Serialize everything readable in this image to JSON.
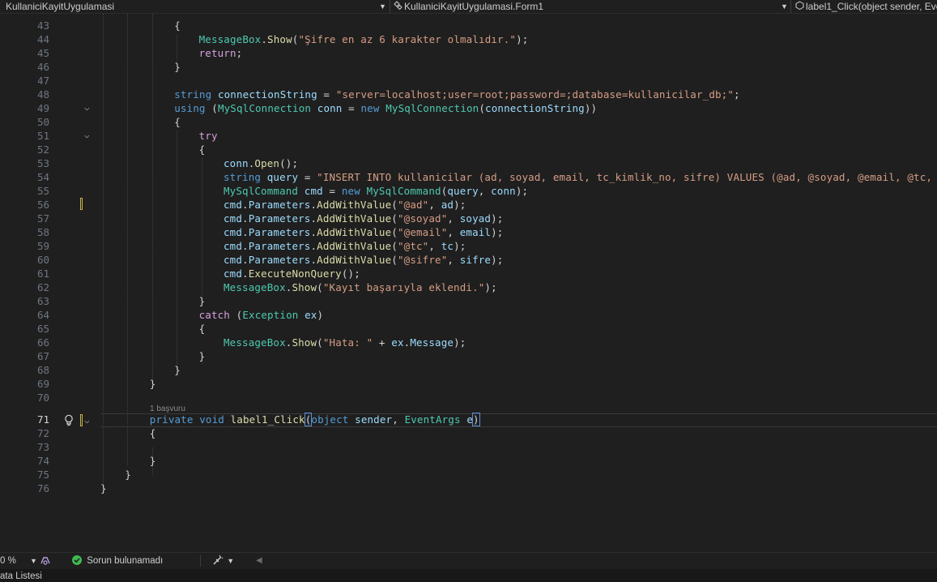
{
  "navbar": {
    "project": "KullaniciKayitUygulamasi",
    "class": "KullaniciKayitUygulamasi.Form1",
    "member": "label1_Click(object sender, Eve"
  },
  "editor": {
    "current_line": 71,
    "codelens": "1 başvuru",
    "lines": [
      {
        "n": 43,
        "tokens": [
          [
            "pl",
            "{"
          ]
        ]
      },
      {
        "n": 44,
        "tokens": [
          [
            "ty",
            "MessageBox"
          ],
          [
            "pl",
            "."
          ],
          [
            "fn",
            "Show"
          ],
          [
            "pl",
            "("
          ],
          [
            "str",
            "\"Şifre en az 6 karakter olmalıdır.\""
          ],
          [
            "pl",
            ");"
          ]
        ]
      },
      {
        "n": 45,
        "tokens": [
          [
            "ctl",
            "return"
          ],
          [
            "pl",
            ";"
          ]
        ]
      },
      {
        "n": 46,
        "tokens": [
          [
            "pl",
            "}"
          ]
        ]
      },
      {
        "n": 47,
        "tokens": []
      },
      {
        "n": 48,
        "tokens": [
          [
            "kw",
            "string"
          ],
          [
            "pl",
            " "
          ],
          [
            "var",
            "connectionString"
          ],
          [
            "pl",
            " = "
          ],
          [
            "str",
            "\"server=localhost;user=root;password=;database=kullanicilar_db;\""
          ],
          [
            "pl",
            ";"
          ]
        ]
      },
      {
        "n": 49,
        "tokens": [
          [
            "kw",
            "using"
          ],
          [
            "pl",
            " ("
          ],
          [
            "ty",
            "MySqlConnection"
          ],
          [
            "pl",
            " "
          ],
          [
            "var",
            "conn"
          ],
          [
            "pl",
            " = "
          ],
          [
            "kw",
            "new"
          ],
          [
            "pl",
            " "
          ],
          [
            "ty",
            "MySqlConnection"
          ],
          [
            "pl",
            "("
          ],
          [
            "var",
            "connectionString"
          ],
          [
            "pl",
            "))"
          ]
        ]
      },
      {
        "n": 50,
        "tokens": [
          [
            "pl",
            "{"
          ]
        ]
      },
      {
        "n": 51,
        "tokens": [
          [
            "ctl",
            "try"
          ]
        ]
      },
      {
        "n": 52,
        "tokens": [
          [
            "pl",
            "{"
          ]
        ]
      },
      {
        "n": 53,
        "tokens": [
          [
            "var",
            "conn"
          ],
          [
            "pl",
            "."
          ],
          [
            "fn",
            "Open"
          ],
          [
            "pl",
            "();"
          ]
        ]
      },
      {
        "n": 54,
        "tokens": [
          [
            "kw",
            "string"
          ],
          [
            "pl",
            " "
          ],
          [
            "var",
            "query"
          ],
          [
            "pl",
            " = "
          ],
          [
            "str",
            "\"INSERT INTO kullanicilar (ad, soyad, email, tc_kimlik_no, sifre) VALUES (@ad, @soyad, @email, @tc, @"
          ]
        ]
      },
      {
        "n": 55,
        "tokens": [
          [
            "ty",
            "MySqlCommand"
          ],
          [
            "pl",
            " "
          ],
          [
            "var",
            "cmd"
          ],
          [
            "pl",
            " = "
          ],
          [
            "kw",
            "new"
          ],
          [
            "pl",
            " "
          ],
          [
            "ty",
            "MySqlCommand"
          ],
          [
            "pl",
            "("
          ],
          [
            "var",
            "query"
          ],
          [
            "pl",
            ", "
          ],
          [
            "var",
            "conn"
          ],
          [
            "pl",
            ");"
          ]
        ]
      },
      {
        "n": 56,
        "tokens": [
          [
            "var",
            "cmd"
          ],
          [
            "pl",
            "."
          ],
          [
            "var",
            "Parameters"
          ],
          [
            "pl",
            "."
          ],
          [
            "fn",
            "AddWithValue"
          ],
          [
            "pl",
            "("
          ],
          [
            "str",
            "\"@ad\""
          ],
          [
            "pl",
            ", "
          ],
          [
            "var",
            "ad"
          ],
          [
            "pl",
            ");"
          ]
        ]
      },
      {
        "n": 57,
        "tokens": [
          [
            "var",
            "cmd"
          ],
          [
            "pl",
            "."
          ],
          [
            "var",
            "Parameters"
          ],
          [
            "pl",
            "."
          ],
          [
            "fn",
            "AddWithValue"
          ],
          [
            "pl",
            "("
          ],
          [
            "str",
            "\"@soyad\""
          ],
          [
            "pl",
            ", "
          ],
          [
            "var",
            "soyad"
          ],
          [
            "pl",
            ");"
          ]
        ]
      },
      {
        "n": 58,
        "tokens": [
          [
            "var",
            "cmd"
          ],
          [
            "pl",
            "."
          ],
          [
            "var",
            "Parameters"
          ],
          [
            "pl",
            "."
          ],
          [
            "fn",
            "AddWithValue"
          ],
          [
            "pl",
            "("
          ],
          [
            "str",
            "\"@email\""
          ],
          [
            "pl",
            ", "
          ],
          [
            "var",
            "email"
          ],
          [
            "pl",
            ");"
          ]
        ]
      },
      {
        "n": 59,
        "tokens": [
          [
            "var",
            "cmd"
          ],
          [
            "pl",
            "."
          ],
          [
            "var",
            "Parameters"
          ],
          [
            "pl",
            "."
          ],
          [
            "fn",
            "AddWithValue"
          ],
          [
            "pl",
            "("
          ],
          [
            "str",
            "\"@tc\""
          ],
          [
            "pl",
            ", "
          ],
          [
            "var",
            "tc"
          ],
          [
            "pl",
            ");"
          ]
        ]
      },
      {
        "n": 60,
        "tokens": [
          [
            "var",
            "cmd"
          ],
          [
            "pl",
            "."
          ],
          [
            "var",
            "Parameters"
          ],
          [
            "pl",
            "."
          ],
          [
            "fn",
            "AddWithValue"
          ],
          [
            "pl",
            "("
          ],
          [
            "str",
            "\"@sifre\""
          ],
          [
            "pl",
            ", "
          ],
          [
            "var",
            "sifre"
          ],
          [
            "pl",
            ");"
          ]
        ]
      },
      {
        "n": 61,
        "tokens": [
          [
            "var",
            "cmd"
          ],
          [
            "pl",
            "."
          ],
          [
            "fn",
            "ExecuteNonQuery"
          ],
          [
            "pl",
            "();"
          ]
        ]
      },
      {
        "n": 62,
        "tokens": [
          [
            "ty",
            "MessageBox"
          ],
          [
            "pl",
            "."
          ],
          [
            "fn",
            "Show"
          ],
          [
            "pl",
            "("
          ],
          [
            "str",
            "\"Kayıt başarıyla eklendi.\""
          ],
          [
            "pl",
            ");"
          ]
        ]
      },
      {
        "n": 63,
        "tokens": [
          [
            "pl",
            "}"
          ]
        ]
      },
      {
        "n": 64,
        "tokens": [
          [
            "ctl",
            "catch"
          ],
          [
            "pl",
            " ("
          ],
          [
            "ty",
            "Exception"
          ],
          [
            "pl",
            " "
          ],
          [
            "var",
            "ex"
          ],
          [
            "pl",
            ")"
          ]
        ]
      },
      {
        "n": 65,
        "tokens": [
          [
            "pl",
            "{"
          ]
        ]
      },
      {
        "n": 66,
        "tokens": [
          [
            "ty",
            "MessageBox"
          ],
          [
            "pl",
            "."
          ],
          [
            "fn",
            "Show"
          ],
          [
            "pl",
            "("
          ],
          [
            "str",
            "\"Hata: \""
          ],
          [
            "pl",
            " + "
          ],
          [
            "var",
            "ex"
          ],
          [
            "pl",
            "."
          ],
          [
            "var",
            "Message"
          ],
          [
            "pl",
            ");"
          ]
        ]
      },
      {
        "n": 67,
        "tokens": [
          [
            "pl",
            "}"
          ]
        ]
      },
      {
        "n": 68,
        "tokens": [
          [
            "pl",
            "}"
          ]
        ]
      },
      {
        "n": 69,
        "tokens": [
          [
            "pl",
            "}"
          ]
        ]
      },
      {
        "n": 70,
        "tokens": []
      },
      {
        "n": 71,
        "tokens": [
          [
            "kw",
            "private"
          ],
          [
            "pl",
            " "
          ],
          [
            "kw",
            "void"
          ],
          [
            "pl",
            " "
          ],
          [
            "fn",
            "label1_Click"
          ],
          [
            "hl",
            "("
          ],
          [
            "kw",
            "object"
          ],
          [
            "pl",
            " "
          ],
          [
            "var",
            "sender"
          ],
          [
            "pl",
            ", "
          ],
          [
            "ty",
            "EventArgs"
          ],
          [
            "pl",
            " "
          ],
          [
            "var",
            "e"
          ],
          [
            "hl",
            ")"
          ]
        ]
      },
      {
        "n": 72,
        "tokens": [
          [
            "pl",
            "{"
          ]
        ]
      },
      {
        "n": 73,
        "tokens": []
      },
      {
        "n": 74,
        "tokens": [
          [
            "pl",
            "}"
          ]
        ]
      },
      {
        "n": 75,
        "tokens": [
          [
            "pl",
            "}"
          ]
        ]
      },
      {
        "n": 76,
        "tokens": [
          [
            "pl",
            "}"
          ]
        ]
      }
    ]
  },
  "statusbar": {
    "zoom": "0 %",
    "issues": "Sorun bulunamadı"
  },
  "bottom_tab": {
    "label": "ata Listesi"
  },
  "colors": {
    "background": "#1f1f1f",
    "keyword": "#569cd6",
    "control": "#d8a0df",
    "type": "#4ec9b0",
    "method": "#dcdcaa",
    "string": "#d69d85",
    "variable": "#9cdcfe",
    "ok_status": "#3fb950"
  },
  "icons": [
    "chevron-down-icon",
    "class-icon",
    "method-icon",
    "fold-chevron-icon",
    "lightbulb-icon",
    "check-circle-icon",
    "brush-icon"
  ]
}
